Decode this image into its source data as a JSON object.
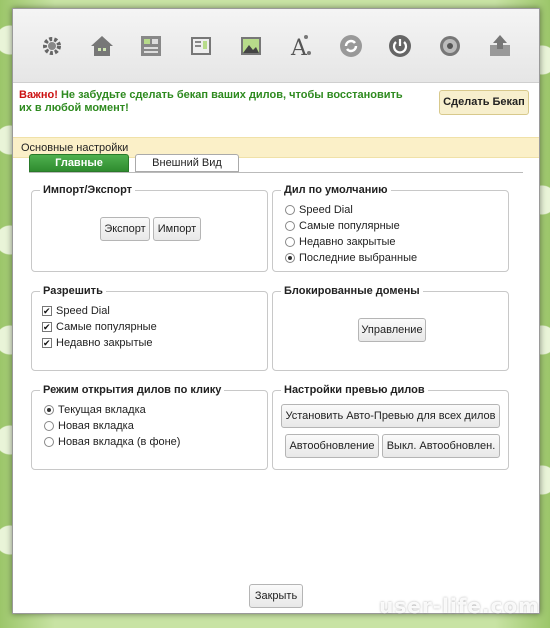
{
  "toolbar": {
    "icons": [
      "gear-icon",
      "home-icon",
      "dials-icon",
      "sites-icon",
      "image-icon",
      "font-icon",
      "refresh-icon",
      "power-icon",
      "globe-icon",
      "export-icon"
    ]
  },
  "alert": {
    "important": "Важно!",
    "message": " Не забудьте сделать бекап ваших дилов, чтобы восстановить их в любой момент!",
    "backup_button": "Сделать Бекап"
  },
  "section": {
    "title": "Основные настройки"
  },
  "tabs": [
    {
      "label": "Главные",
      "active": true
    },
    {
      "label": "Внешний Вид",
      "active": false
    }
  ],
  "import_export": {
    "legend": "Импорт/Экспорт",
    "export_button": "Экспорт",
    "import_button": "Импорт"
  },
  "default_dial": {
    "legend": "Дил по умолчанию",
    "options": [
      {
        "label": "Speed Dial",
        "selected": false
      },
      {
        "label": "Самые популярные",
        "selected": false
      },
      {
        "label": "Недавно закрытые",
        "selected": false
      },
      {
        "label": "Последние выбранные",
        "selected": true
      }
    ]
  },
  "allow": {
    "legend": "Разрешить",
    "options": [
      {
        "label": "Speed Dial",
        "checked": true
      },
      {
        "label": "Самые популярные",
        "checked": true
      },
      {
        "label": "Недавно закрытые",
        "checked": true
      }
    ]
  },
  "blocked": {
    "legend": "Блокированные домены",
    "manage_button": "Управление"
  },
  "open_mode": {
    "legend": "Режим открытия дилов по клику",
    "options": [
      {
        "label": "Текущая вкладка",
        "selected": true
      },
      {
        "label": "Новая вкладка",
        "selected": false
      },
      {
        "label": "Новая вкладка (в фоне)",
        "selected": false
      }
    ]
  },
  "preview": {
    "legend": "Настройки превью дилов",
    "auto_preview_button": "Установить Авто-Превью для всех дилов",
    "autoupdate_button": "Автообновление",
    "disable_autoupdate_button": "Выкл. Автообновлен."
  },
  "footer": {
    "close_button": "Закрыть"
  },
  "watermark": "user-life.com"
}
